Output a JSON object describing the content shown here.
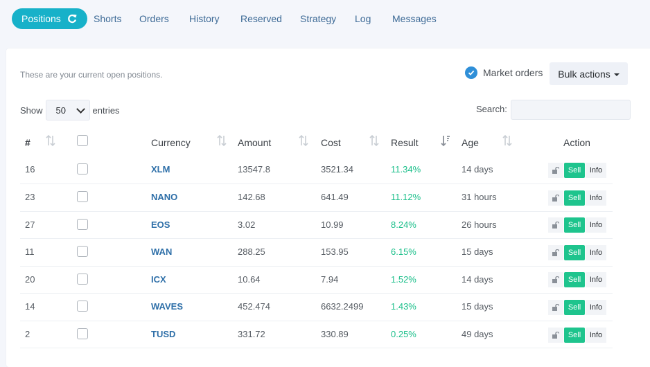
{
  "nav": {
    "tabs": [
      {
        "label": "Positions",
        "active": true
      },
      {
        "label": "Shorts"
      },
      {
        "label": "Orders"
      },
      {
        "label": "History"
      },
      {
        "label": "Reserved"
      },
      {
        "label": "Strategy"
      },
      {
        "label": "Log"
      },
      {
        "label": "Messages"
      }
    ]
  },
  "panel": {
    "intro": "These are your current open positions.",
    "market_orders_label": "Market orders",
    "market_orders_checked": true,
    "bulk_actions_label": "Bulk actions",
    "show_label": "Show",
    "entries_value": "50",
    "entries_label": "entries",
    "search_label": "Search:",
    "search_value": ""
  },
  "table": {
    "headers": [
      "#",
      "Currency",
      "Amount",
      "Cost",
      "Result",
      "Age",
      "Action"
    ],
    "sort_column": "Result",
    "rows": [
      {
        "id": "16",
        "currency": "XLM",
        "amount": "13547.8",
        "cost": "3521.34",
        "result": "11.34%",
        "age": "14 days"
      },
      {
        "id": "23",
        "currency": "NANO",
        "amount": "142.68",
        "cost": "641.49",
        "result": "11.12%",
        "age": "31 hours"
      },
      {
        "id": "27",
        "currency": "EOS",
        "amount": "3.02",
        "cost": "10.99",
        "result": "8.24%",
        "age": "26 hours"
      },
      {
        "id": "11",
        "currency": "WAN",
        "amount": "288.25",
        "cost": "153.95",
        "result": "6.15%",
        "age": "15 days"
      },
      {
        "id": "20",
        "currency": "ICX",
        "amount": "10.64",
        "cost": "7.94",
        "result": "1.52%",
        "age": "14 days"
      },
      {
        "id": "14",
        "currency": "WAVES",
        "amount": "452.474",
        "cost": "6632.2499",
        "result": "1.43%",
        "age": "15 days"
      },
      {
        "id": "2",
        "currency": "TUSD",
        "amount": "331.72",
        "cost": "330.89",
        "result": "0.25%",
        "age": "49 days"
      }
    ],
    "sell_label": "Sell",
    "info_label": "Info"
  },
  "colors": {
    "accent": "#17b1c9",
    "link": "#2e6fa8",
    "positive": "#1bbf8a",
    "sell": "#1ec48d"
  },
  "icons": [
    "refresh-icon",
    "checkmark-icon",
    "caret-down-icon",
    "sort-icon",
    "lock-icon"
  ]
}
